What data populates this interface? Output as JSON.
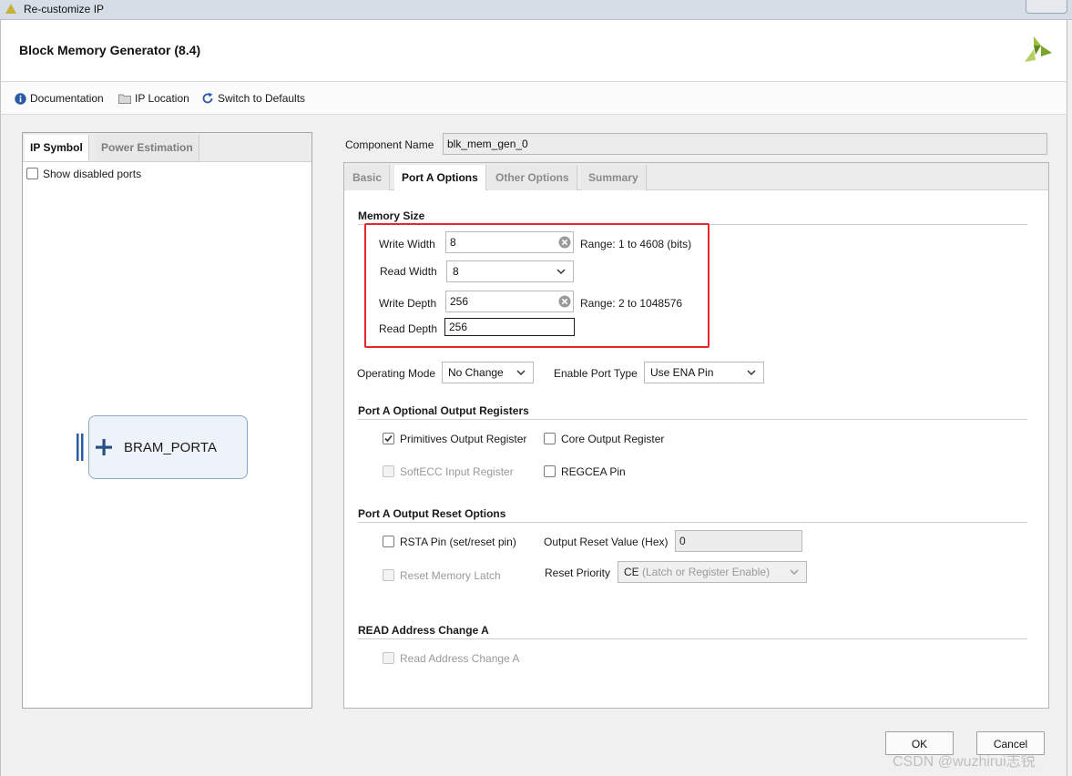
{
  "window": {
    "title": "Re-customize IP"
  },
  "header": {
    "title": "Block Memory Generator (8.4)"
  },
  "toolbar": {
    "documentation": "Documentation",
    "ip_location": "IP Location",
    "switch_defaults": "Switch to Defaults"
  },
  "left_panel": {
    "tabs": [
      "IP Symbol",
      "Power Estimation"
    ],
    "show_disabled_ports": "Show disabled ports",
    "port_label": "BRAM_PORTA"
  },
  "component": {
    "label": "Component Name",
    "value": "blk_mem_gen_0"
  },
  "tabs": [
    "Basic",
    "Port A Options",
    "Other Options",
    "Summary"
  ],
  "memory_size": {
    "title": "Memory Size",
    "write_width_label": "Write Width",
    "write_width_value": "8",
    "write_width_range": "Range: 1 to 4608 (bits)",
    "read_width_label": "Read Width",
    "read_width_value": "8",
    "write_depth_label": "Write Depth",
    "write_depth_value": "256",
    "write_depth_range": "Range: 2 to 1048576",
    "read_depth_label": "Read Depth",
    "read_depth_value": "256"
  },
  "operating": {
    "mode_label": "Operating Mode",
    "mode_value": "No Change",
    "enable_label": "Enable Port Type",
    "enable_value": "Use ENA Pin"
  },
  "optional_registers": {
    "title": "Port A Optional Output Registers",
    "primitives": "Primitives Output Register",
    "primitives_checked": true,
    "core": "Core Output Register",
    "softecc": "SoftECC Input Register",
    "regcea": "REGCEA Pin"
  },
  "reset_options": {
    "title": "Port A Output Reset Options",
    "rsta": "RSTA Pin (set/reset pin)",
    "output_reset_label": "Output Reset Value (Hex)",
    "output_reset_value": "0",
    "reset_latch": "Reset Memory Latch",
    "reset_priority_label": "Reset Priority",
    "reset_priority_value_main": "CE",
    "reset_priority_value_rest": " (Latch or Register Enable)"
  },
  "read_address": {
    "title": "READ Address Change A",
    "checkbox": "Read Address Change A"
  },
  "buttons": {
    "ok": "OK",
    "cancel": "Cancel"
  },
  "watermark": "CSDN @wuzhirui志锐",
  "colors": {
    "highlight_box": "#e5262b",
    "xilinx_logo": "#8cb23f"
  }
}
